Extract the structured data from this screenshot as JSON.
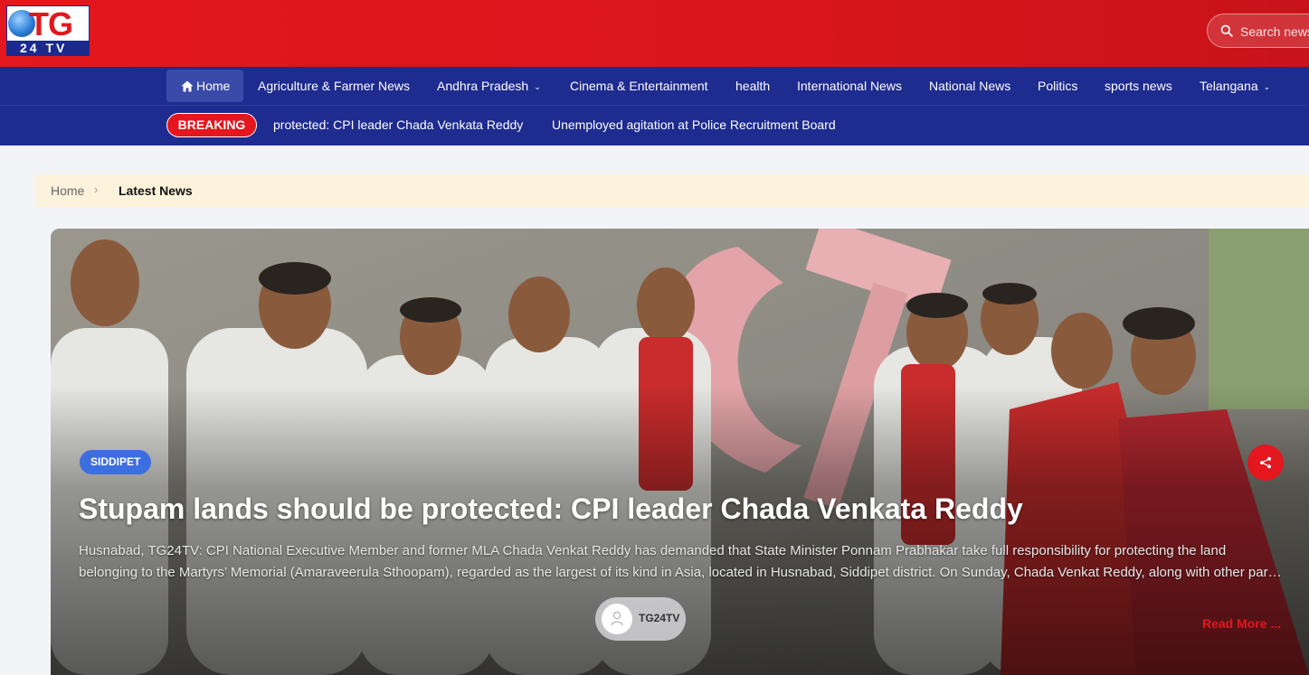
{
  "brand": {
    "logo_main": "TG",
    "logo_sub": "24 TV"
  },
  "search": {
    "placeholder": "Search news..."
  },
  "nav": {
    "items": [
      {
        "label": "Home",
        "active": true
      },
      {
        "label": "Agriculture & Farmer News"
      },
      {
        "label": "Andhra Pradesh",
        "has_dropdown": true
      },
      {
        "label": "Cinema & Entertainment"
      },
      {
        "label": "health"
      },
      {
        "label": "International News"
      },
      {
        "label": "National News"
      },
      {
        "label": "Politics"
      },
      {
        "label": "sports news"
      },
      {
        "label": "Telangana",
        "has_dropdown": true
      }
    ]
  },
  "breaking": {
    "label": "BREAKING",
    "items": [
      "protected: CPI leader Chada Venkata Reddy",
      "Unemployed agitation at Police Recruitment Board"
    ]
  },
  "breadcrumb": {
    "home": "Home",
    "current": "Latest News"
  },
  "hero": {
    "category": "SIDDIPET",
    "title": "Stupam lands should be protected: CPI leader Chada Venkata Reddy",
    "excerpt": "Husnabad, TG24TV: CPI National Executive Member and former MLA Chada Venkat Reddy has demanded that State Minister Ponnam Prabhakar take full responsibility for protecting the land belonging to the Martyrs’ Memorial (Amaraveerula Sthoopam), regarded as the largest of its kind in Asia, located in Husnabad, Siddipet district. On Sunday, Chada Venkat Reddy, along with other party leaders, visited the memorial site and inspected the lands.",
    "author": "TG24TV",
    "read_more": "Read More ..."
  },
  "colors": {
    "header_red": "#e3171d",
    "nav_blue": "#1e2b8f",
    "badge_blue": "#3d6ee0",
    "breadcrumb_bg": "#fdf3dc"
  },
  "icons": [
    "home-icon",
    "search-icon",
    "chevron-down-icon",
    "chevron-right-icon",
    "share-icon",
    "user-icon"
  ]
}
